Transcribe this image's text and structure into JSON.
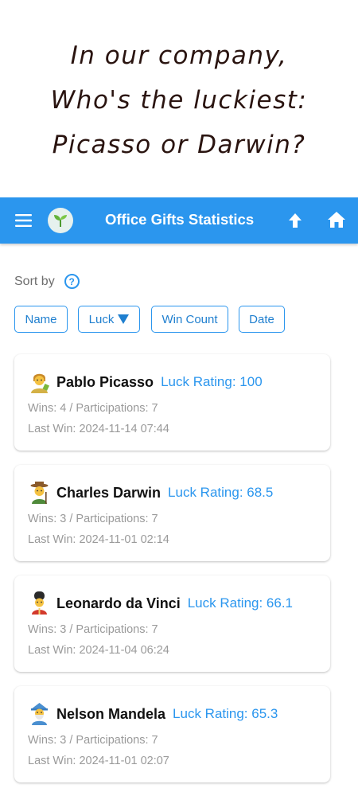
{
  "hero": {
    "line1": "In our company,",
    "line2": "Who's the luckiest:",
    "line3": "Picasso or Darwin?"
  },
  "appbar": {
    "title": "Office Gifts Statistics",
    "color": "#2b96ee",
    "icons": [
      "menu-icon",
      "sprout-logo-icon",
      "arrow-up-icon",
      "home-icon"
    ]
  },
  "sort": {
    "label": "Sort by",
    "options": [
      "Name",
      "Luck",
      "Win Count",
      "Date"
    ],
    "active": "Luck"
  },
  "people": [
    {
      "name": "Pablo Picasso",
      "avatar": "artist-avatar-icon",
      "luck": "Luck Rating: 100",
      "stats": "Wins: 4 / Participations: 7",
      "last_win": "Last Win: 2024-11-14 07:44"
    },
    {
      "name": "Charles Darwin",
      "avatar": "farmer-avatar-icon",
      "luck": "Luck Rating: 68.5",
      "stats": "Wins: 3 / Participations: 7",
      "last_win": "Last Win: 2024-11-01 02:14"
    },
    {
      "name": "Leonardo da Vinci",
      "avatar": "guard-avatar-icon",
      "luck": "Luck Rating: 66.1",
      "stats": "Wins: 3 / Participations: 7",
      "last_win": "Last Win: 2024-11-04 06:24"
    },
    {
      "name": "Nelson Mandela",
      "avatar": "mage-avatar-icon",
      "luck": "Luck Rating: 65.3",
      "stats": "Wins: 3 / Participations: 7",
      "last_win": "Last Win: 2024-11-01 02:07"
    }
  ]
}
